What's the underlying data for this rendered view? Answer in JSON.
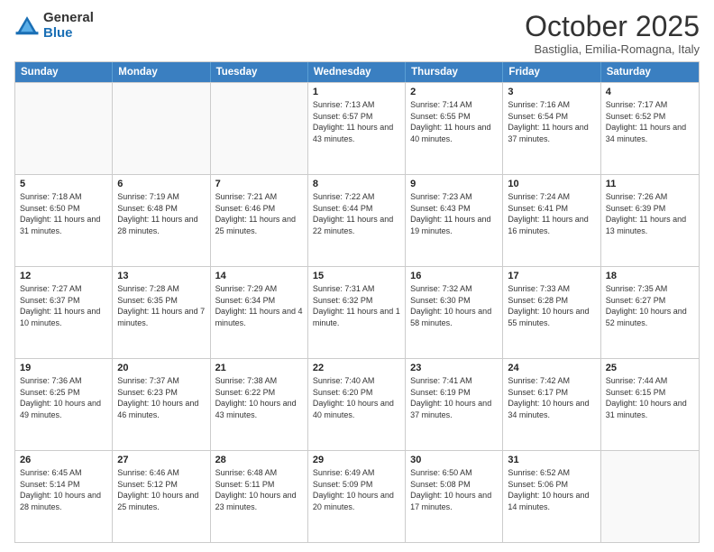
{
  "logo": {
    "general": "General",
    "blue": "Blue"
  },
  "title": "October 2025",
  "location": "Bastiglia, Emilia-Romagna, Italy",
  "header_days": [
    "Sunday",
    "Monday",
    "Tuesday",
    "Wednesday",
    "Thursday",
    "Friday",
    "Saturday"
  ],
  "weeks": [
    [
      {
        "day": "",
        "sunrise": "",
        "sunset": "",
        "daylight": ""
      },
      {
        "day": "",
        "sunrise": "",
        "sunset": "",
        "daylight": ""
      },
      {
        "day": "",
        "sunrise": "",
        "sunset": "",
        "daylight": ""
      },
      {
        "day": "1",
        "sunrise": "7:13 AM",
        "sunset": "6:57 PM",
        "daylight": "11 hours and 43 minutes."
      },
      {
        "day": "2",
        "sunrise": "7:14 AM",
        "sunset": "6:55 PM",
        "daylight": "11 hours and 40 minutes."
      },
      {
        "day": "3",
        "sunrise": "7:16 AM",
        "sunset": "6:54 PM",
        "daylight": "11 hours and 37 minutes."
      },
      {
        "day": "4",
        "sunrise": "7:17 AM",
        "sunset": "6:52 PM",
        "daylight": "11 hours and 34 minutes."
      }
    ],
    [
      {
        "day": "5",
        "sunrise": "7:18 AM",
        "sunset": "6:50 PM",
        "daylight": "11 hours and 31 minutes."
      },
      {
        "day": "6",
        "sunrise": "7:19 AM",
        "sunset": "6:48 PM",
        "daylight": "11 hours and 28 minutes."
      },
      {
        "day": "7",
        "sunrise": "7:21 AM",
        "sunset": "6:46 PM",
        "daylight": "11 hours and 25 minutes."
      },
      {
        "day": "8",
        "sunrise": "7:22 AM",
        "sunset": "6:44 PM",
        "daylight": "11 hours and 22 minutes."
      },
      {
        "day": "9",
        "sunrise": "7:23 AM",
        "sunset": "6:43 PM",
        "daylight": "11 hours and 19 minutes."
      },
      {
        "day": "10",
        "sunrise": "7:24 AM",
        "sunset": "6:41 PM",
        "daylight": "11 hours and 16 minutes."
      },
      {
        "day": "11",
        "sunrise": "7:26 AM",
        "sunset": "6:39 PM",
        "daylight": "11 hours and 13 minutes."
      }
    ],
    [
      {
        "day": "12",
        "sunrise": "7:27 AM",
        "sunset": "6:37 PM",
        "daylight": "11 hours and 10 minutes."
      },
      {
        "day": "13",
        "sunrise": "7:28 AM",
        "sunset": "6:35 PM",
        "daylight": "11 hours and 7 minutes."
      },
      {
        "day": "14",
        "sunrise": "7:29 AM",
        "sunset": "6:34 PM",
        "daylight": "11 hours and 4 minutes."
      },
      {
        "day": "15",
        "sunrise": "7:31 AM",
        "sunset": "6:32 PM",
        "daylight": "11 hours and 1 minute."
      },
      {
        "day": "16",
        "sunrise": "7:32 AM",
        "sunset": "6:30 PM",
        "daylight": "10 hours and 58 minutes."
      },
      {
        "day": "17",
        "sunrise": "7:33 AM",
        "sunset": "6:28 PM",
        "daylight": "10 hours and 55 minutes."
      },
      {
        "day": "18",
        "sunrise": "7:35 AM",
        "sunset": "6:27 PM",
        "daylight": "10 hours and 52 minutes."
      }
    ],
    [
      {
        "day": "19",
        "sunrise": "7:36 AM",
        "sunset": "6:25 PM",
        "daylight": "10 hours and 49 minutes."
      },
      {
        "day": "20",
        "sunrise": "7:37 AM",
        "sunset": "6:23 PM",
        "daylight": "10 hours and 46 minutes."
      },
      {
        "day": "21",
        "sunrise": "7:38 AM",
        "sunset": "6:22 PM",
        "daylight": "10 hours and 43 minutes."
      },
      {
        "day": "22",
        "sunrise": "7:40 AM",
        "sunset": "6:20 PM",
        "daylight": "10 hours and 40 minutes."
      },
      {
        "day": "23",
        "sunrise": "7:41 AM",
        "sunset": "6:19 PM",
        "daylight": "10 hours and 37 minutes."
      },
      {
        "day": "24",
        "sunrise": "7:42 AM",
        "sunset": "6:17 PM",
        "daylight": "10 hours and 34 minutes."
      },
      {
        "day": "25",
        "sunrise": "7:44 AM",
        "sunset": "6:15 PM",
        "daylight": "10 hours and 31 minutes."
      }
    ],
    [
      {
        "day": "26",
        "sunrise": "6:45 AM",
        "sunset": "5:14 PM",
        "daylight": "10 hours and 28 minutes."
      },
      {
        "day": "27",
        "sunrise": "6:46 AM",
        "sunset": "5:12 PM",
        "daylight": "10 hours and 25 minutes."
      },
      {
        "day": "28",
        "sunrise": "6:48 AM",
        "sunset": "5:11 PM",
        "daylight": "10 hours and 23 minutes."
      },
      {
        "day": "29",
        "sunrise": "6:49 AM",
        "sunset": "5:09 PM",
        "daylight": "10 hours and 20 minutes."
      },
      {
        "day": "30",
        "sunrise": "6:50 AM",
        "sunset": "5:08 PM",
        "daylight": "10 hours and 17 minutes."
      },
      {
        "day": "31",
        "sunrise": "6:52 AM",
        "sunset": "5:06 PM",
        "daylight": "10 hours and 14 minutes."
      },
      {
        "day": "",
        "sunrise": "",
        "sunset": "",
        "daylight": ""
      }
    ]
  ]
}
